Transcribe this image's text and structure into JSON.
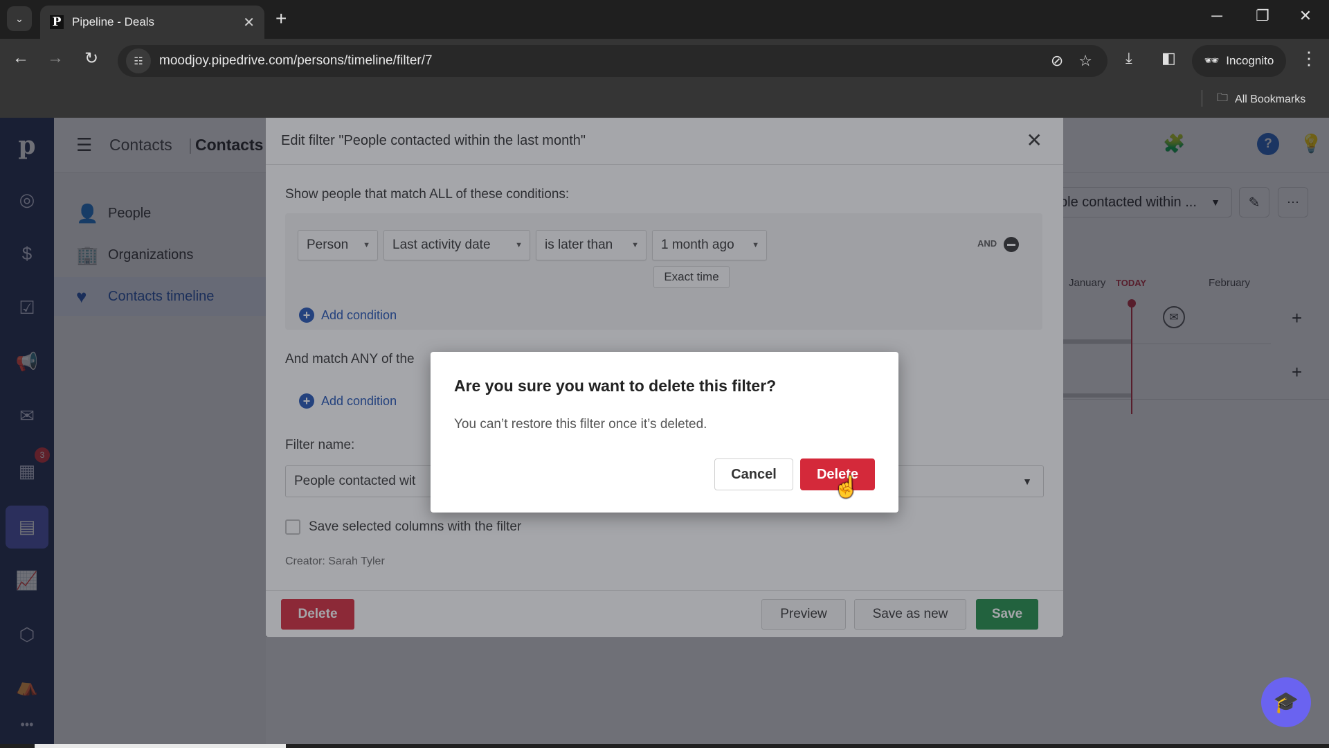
{
  "browser": {
    "tab_title": "Pipeline - Deals",
    "tab_favicon": "P",
    "url": "moodjoy.pipedrive.com/persons/timeline/filter/7",
    "profile_label": "Incognito",
    "bookmarks_label": "All Bookmarks"
  },
  "app": {
    "logo": "p",
    "notification_count": "3",
    "breadcrumb": [
      "Contacts",
      "Contacts"
    ],
    "subnav": [
      {
        "label": "People",
        "active": false
      },
      {
        "label": "Organizations",
        "active": false
      },
      {
        "label": "Contacts timeline",
        "active": true
      }
    ],
    "filter_select_value": "ple contacted within ...",
    "timeline": {
      "months": [
        "January",
        "February"
      ],
      "today_label": "TODAY"
    }
  },
  "edit_filter": {
    "title": "Edit filter \"People contacted within the last month\"",
    "all_conditions_label": "Show people that match ALL of these conditions:",
    "condition": {
      "object": "Person",
      "field": "Last activity date",
      "operator": "is later than",
      "value": "1 month ago",
      "exact_time_label": "Exact time",
      "joiner": "AND"
    },
    "add_condition_label": "Add condition",
    "any_conditions_label": "And match ANY of the",
    "filter_name_label": "Filter name:",
    "filter_name_value": "People contacted wit",
    "save_columns_label": "Save selected columns with the filter",
    "save_columns_checked": false,
    "creator": "Creator: Sarah Tyler",
    "buttons": {
      "delete": "Delete",
      "preview": "Preview",
      "save_as_new": "Save as new",
      "save": "Save"
    }
  },
  "confirm_dialog": {
    "title": "Are you sure you want to delete this filter?",
    "message": "You can’t restore this filter once it’s deleted.",
    "cancel": "Cancel",
    "delete": "Delete"
  },
  "colors": {
    "danger": "#d4293a",
    "success": "#1e8a45",
    "link": "#2153b4",
    "nav_bg": "#1e2a4f",
    "academy": "#6a63f0"
  }
}
